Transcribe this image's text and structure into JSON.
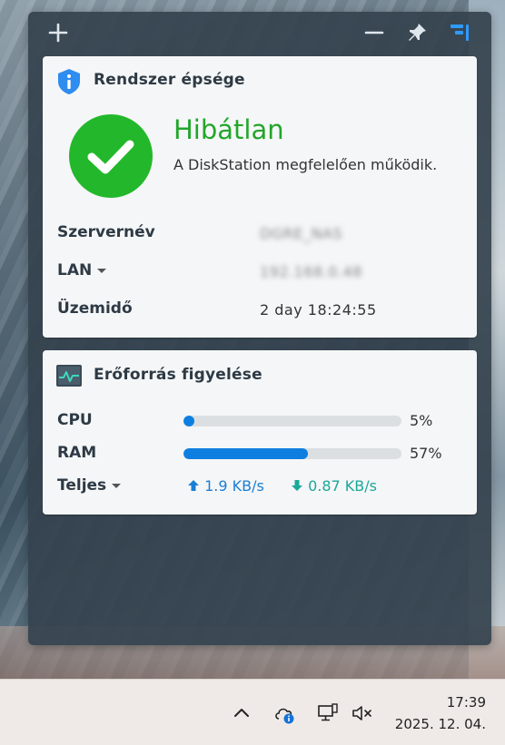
{
  "panel": {
    "health": {
      "title": "Rendszer épsége",
      "status": "Hibátlan",
      "description": "A DiskStation megfelelően működik.",
      "rows": [
        {
          "label": "Szervernév",
          "value": "DGRE_NAS",
          "blurred": true
        },
        {
          "label": "LAN",
          "value": "192.168.0.48",
          "blurred": true
        },
        {
          "label": "Üzemidő",
          "value": "2 day 18:24:55",
          "blurred": false
        }
      ]
    },
    "resource": {
      "title": "Erőforrás figyelése",
      "cpu": {
        "label": "CPU",
        "percent": 5,
        "percent_text": "5%"
      },
      "ram": {
        "label": "RAM",
        "percent": 57,
        "percent_text": "57%"
      },
      "total": {
        "label": "Teljes",
        "upload": "1.9 KB/s",
        "download": "0.87 KB/s"
      }
    }
  },
  "colors": {
    "ok_green": "#23b82b",
    "bar_blue": "#0e7fe1",
    "upload_blue": "#1a7fd4",
    "download_teal": "#1ba89b"
  },
  "taskbar": {
    "time": "17:39",
    "date": "2025. 12. 04.",
    "icons": [
      "chevron-up-icon",
      "cloud-info-icon",
      "network-icon",
      "volume-muted-icon"
    ]
  }
}
